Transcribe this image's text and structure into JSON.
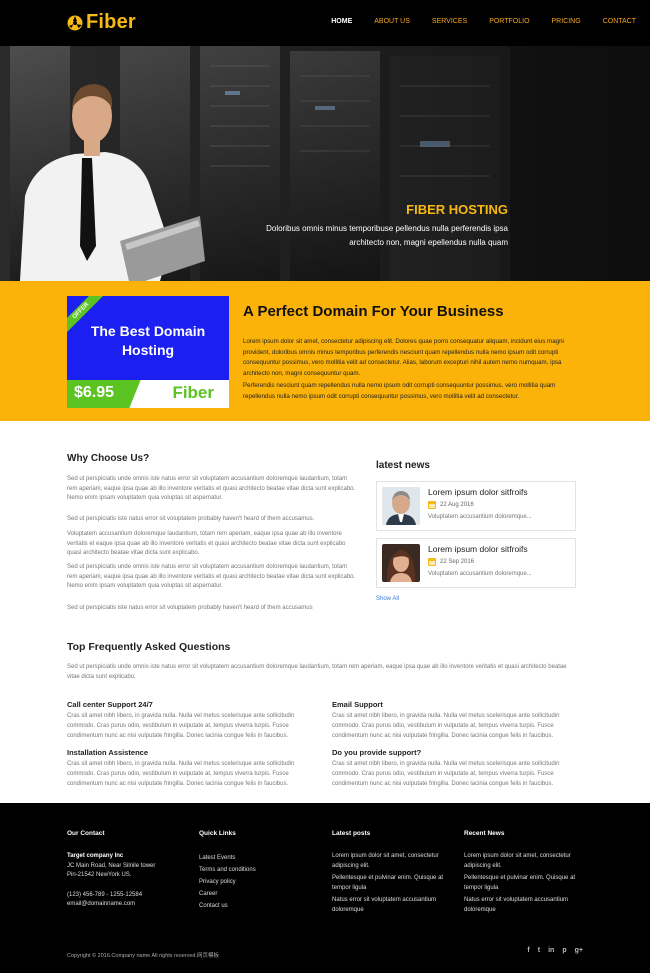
{
  "header": {
    "logo_text": "Fiber",
    "nav": [
      "HOME",
      "ABOUT US",
      "SERVICES",
      "PORTFOLIO",
      "PRICING",
      "CONTACT"
    ]
  },
  "hero": {
    "title": "FIBER HOSTING",
    "subtitle": "Doloribus omnis minus temporibuse pellendus nulla perferendis ipsa architecto non, magni epellendus nulla quam"
  },
  "offer": {
    "ribbon": "OFFER",
    "title": "The Best Domain Hosting",
    "price": "$6.95",
    "brand": "Fiber"
  },
  "intro": {
    "title": "A Perfect Domain For Your Business",
    "p1": "Lorem ipsum dolor sit amet, consectetur adipiscing elit. Dolores quae porro consequatur aliquam, incidunt eius magni provident, doloribus omnis minus temporibus perferendis nesciunt quam repellendus nulla nemo ipsum odit corrupti consequuntur possimus, vero mollitia velit ad consectetur. Alias, laborum excepturi nihil autem nemo numquam, ipsa architecto non, magni consequuntur quam.",
    "p2": "Perferendis nesciunt quam repellendus nulla nemo ipsum odit corrupti consequuntur possimus, vero mollitia quam repellendus nulla nemo ipsum odit corrupti consequuntur possimus, vero mollitia velit ad consectetur."
  },
  "why": {
    "title": "Why Choose Us?",
    "p1": "Sed ut perspiciatis unde omnis iste natus error sit voluptatem accusantium doloremque laudantium, totam rem aperiam, eaque ipsa quae ab illo inventore veritatis et quasi architecto beatae vitae dicta sunt explicabo. Nemo enim ipsam voluptatem quia voluptas sit aspernatur.",
    "p2": "Sed ut perspiciatis iste natus error sit voluptatem probably haven't heard of them accusamus.",
    "p3": "Voluptatem accusantium doloremque laudantium, totam rem aperiam, eaque ipsa quae ab illo inventore veritatis et eaque ipsa quae ab illo inventore veritatis et quasi architecto beatae vitae dicta sunt explicabo quasi architecto beatae vitae dicta sunt explicabo.",
    "p4": "Sed ut perspiciatis unde omnis iste natus error sit voluptatem accusantium doloremque laudantium, totam rem aperiam, eaque ipsa quae ab illo inventore veritatis et quasi architecto beatae vitae dicta sunt explicabo. Nemo enim ipsam voluptatem quia voluptas sit aspernatur.",
    "p5": "Sed ut perspiciatis iste natus error sit voluptatem probably haven't heard of them accusamus"
  },
  "news": {
    "title": "latest news",
    "items": [
      {
        "headline": "Lorem ipsum dolor sitfroifs",
        "date": "22 Aug 2016",
        "desc": "Voluptatem accusantium doloremque..."
      },
      {
        "headline": "Lorem ipsum dolor sitfroifs",
        "date": "22 Sep 2016",
        "desc": "Voluptatem accusantium doloremque..."
      }
    ],
    "show_all": "Show All"
  },
  "faq": {
    "title": "Top Frequently Asked Questions",
    "intro": "Sed ut perspiciatis unde omnis iste natus error sit voluptatem accusantium doloremque laudantium, totam rem aperiam, eaque ipsa quae ab illo inventore veritatis et quasi architecto beatae vitae dicta sunt explicabo.",
    "items": [
      {
        "q": "Call center Support 24/7",
        "a": "Cras sit amet nibh libero, in gravida nulla. Nulla vel metus scelerisque ante sollicitudin commodo. Cras purus odio, vestibulum in vulputate at, tempus viverra turpis. Fusce condimentum nunc ac nisi vulputate fringilla. Donec lacinia congue felis in faucibus."
      },
      {
        "q": "Email Support",
        "a": "Cras sit amet nibh libero, in gravida nulla. Nulla vel metus scelerisque ante sollicitudin commodo. Cras purus odio, vestibulum in vulputate at, tempus viverra turpis. Fusce condimentum nunc ac nisi vulputate fringilla. Donec lacinia congue felis in faucibus."
      },
      {
        "q": "Installation Assistence",
        "a": "Cras sit amet nibh libero, in gravida nulla. Nulla vel metus scelerisque ante sollicitudin commodo. Cras purus odio, vestibulum in vulputate at, tempus viverra turpis. Fusce condimentum nunc ac nisi vulputate fringilla. Donec lacinia congue felis in faucibus."
      },
      {
        "q": "Do you provide support?",
        "a": "Cras sit amet nibh libero, in gravida nulla. Nulla vel metus scelerisque ante sollicitudin commodo. Cras purus odio, vestibulum in vulputate at, tempus viverra turpis. Fusce condimentum nunc ac nisi vulputate fringilla. Donec lacinia congue felis in faucibus."
      }
    ]
  },
  "footer": {
    "contact": {
      "title": "Our Contact",
      "company": "Target company Inc",
      "address1": "JC Main Road, Near Silnile tower",
      "address2": "Pin-21542 NewYork US.",
      "phone": "(123) 456-789 - 1255-12584",
      "email": "email@domainname.com"
    },
    "links": {
      "title": "Quick Links",
      "items": [
        "Latest Events",
        "Terms and conditions",
        "Privacy policy",
        "Career",
        "Contact us"
      ]
    },
    "latest_posts": {
      "title": "Latest posts",
      "items": [
        "Lorem ipsum dolor sit amet, consectetur adipiscing elit.",
        "Pellentesque et pulvinar enim. Quisque at tempor ligula",
        "Natus error sit voluptatem accusantium doloremque"
      ]
    },
    "recent_news": {
      "title": "Recent News",
      "items": [
        "Lorem ipsum dolor sit amet, consectetur adipiscing elit.",
        "Pellentesque et pulvinar enim. Quisque at tempor ligula",
        "Natus error sit voluptatem accusantium doloremque"
      ]
    },
    "copyright": "Copyright © 2016.Company name All rights reserved.网页模板",
    "social": [
      "f",
      "t",
      "in",
      "p",
      "g+"
    ]
  },
  "colors": {
    "accent": "#f7b913",
    "band": "#fbb30a",
    "offer_blue": "#1b1ff0",
    "offer_green": "#5bc322",
    "link_blue": "#3a7bd5"
  },
  "icons": [
    "fiber-logo-icon",
    "calendar-icon",
    "facebook-icon",
    "twitter-icon",
    "linkedin-icon",
    "pinterest-icon",
    "google-plus-icon"
  ]
}
